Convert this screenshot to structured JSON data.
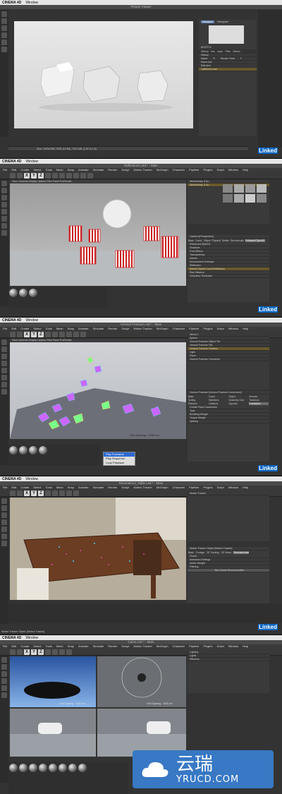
{
  "mac": {
    "app": "CINEMA 4D",
    "menu": "Window"
  },
  "panel1": {
    "title": "Picture Viewer",
    "tabs": [
      "Navigator",
      "Histogram"
    ],
    "zoom": "66.675 %",
    "history_tabs": [
      "History",
      "Info",
      "Layer",
      "Filter",
      "Stereo"
    ],
    "history_header": "History",
    "columns": [
      "Name",
      "R",
      "Render Time",
      "F"
    ],
    "rows": [
      "Mixer.mat",
      "Edit.dem",
      "Optimized.mat"
    ],
    "status": "Size: 1920x1080, RGB (16 Bit), TGA 16B, (1.60 of 1.6)"
  },
  "panel2": {
    "title": "Reflections.c4d * - Main",
    "layout": "Standard",
    "attr_title": "Camera [Perspective]",
    "attr_tabs": [
      "Basic",
      "Coord.",
      "Object",
      "Physical",
      "Details",
      "Stereoscopic",
      "Enhanced OpenGL"
    ],
    "attr_rows": [
      "Enhanced OpenGL",
      "Shadows",
      "Post Effects",
      "Transparency",
      "Noises",
      "Environment Overlays",
      "Reflection",
      "Screen-Space Local Reflections",
      "Ray Distance",
      "Geometry Thickness"
    ],
    "list_rows": [
      "Wednesday, 8 Au...",
      "Wednesday, 8 Au..."
    ]
  },
  "panel3": {
    "title": "Voronoi Fracture.c4d * - Main",
    "layout": "Standard",
    "objects": [
      "Wreck.1",
      "Sphere",
      "Voronoi Fracture Object Tile",
      "Voronoi Fracture Tile",
      "Voronoi Fracture Collision",
      "Light",
      "Plane",
      "Voronoi Fracture Connector"
    ],
    "attr_title": "Voronoi Fracture [Voronoi Fracture Connectors]",
    "attr_tabs": [
      "Basic",
      "Coord.",
      "Object",
      "Sources",
      "Sorting",
      "Selections",
      "Geometry Glue",
      "Transform",
      "Effectors",
      "Collisions",
      "Dynamic",
      "Connectors"
    ],
    "attr_rows": [
      "Create Fixed Connectors",
      "Type",
      "Breaking Weight",
      "Torque Weight",
      "Upkeep"
    ],
    "menu": [
      "Play Forwards",
      "Play Sequence",
      "Loop Playback"
    ],
    "grid": "Grid Spacing : 1000 cm"
  },
  "panel4": {
    "title": "Reconstruct_Table.c4d * - Main",
    "layout": "Standard",
    "tree": [
      "Motion Tracker"
    ],
    "attr_title": "Motion Tracker Object [Motion Tracker]",
    "attr_tabs": [
      "Basic",
      "Footage",
      "2D Tracking",
      "3D Solver",
      "Reconstruction"
    ],
    "attr_rows": [
      "Preset",
      "Advanced Settings",
      "Vertex Weight",
      "Filtering",
      "Run Scene Reconstruction"
    ],
    "bottom_label": "Motion Tracker Object: [Motion Tracker]"
  },
  "panel5": {
    "title": "Cams.c4d * - Main",
    "layout": "Standard",
    "tree": [
      "Lighting",
      "Lights",
      "Effectors"
    ],
    "left_grid": "Grid Spacing : 1000 cm",
    "right_grid": "Grid Spacing : 1000 cm"
  },
  "watermark": {
    "linked": "Linked",
    "in": "in"
  },
  "badge": {
    "cn": "云瑞",
    "en": "YRUCD.COM"
  }
}
